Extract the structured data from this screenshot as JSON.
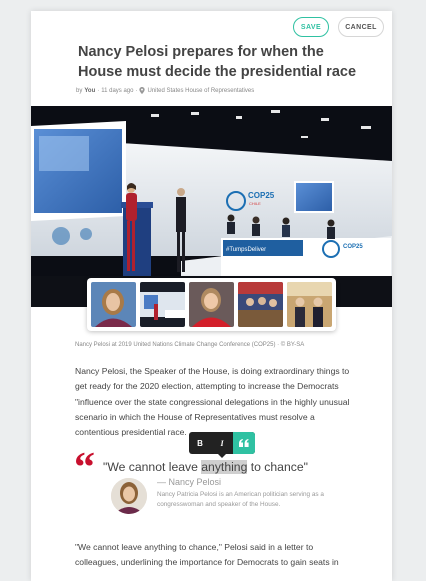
{
  "toolbar": {
    "save_label": "SAVE",
    "cancel_label": "CANCEL"
  },
  "article": {
    "title": "Nancy Pelosi prepares for when the House must decide the presidential race",
    "meta": {
      "by": "by",
      "author": "You",
      "time": "11 days ago",
      "location": "United States House of Representatives"
    },
    "caption": "Nancy Pelosi at 2019 United Nations Climate Change Conference (COP25) · © BY-SA",
    "paragraph1": "Nancy Pelosi, the Speaker of the House, is doing extraordinary things to get ready for the 2020 election, attempting to increase the Democrats \"influence over the state congressional delegations in the highly unusual scenario in which the House of Representatives must resolve a contentious presidential race.",
    "paragraph2": "\"We cannot leave anything to chance,\" Pelosi said in a letter to colleagues, underlining the importance for Democrats to gain seats in"
  },
  "hero": {
    "banner_text": "#TumpsDeliver",
    "logo_text": "COP25",
    "logo_sub": "CHILE"
  },
  "format_toolbar": {
    "bold": "B",
    "italic": "I",
    "quote_icon": "quote-icon"
  },
  "quote": {
    "before": "\"We cannot leave ",
    "highlight": "anything",
    "after": " to chance\"",
    "author": "—  Nancy Pelosi",
    "bio": "Nancy Patricia Pelosi is an American politician serving as a congresswoman and speaker of the House."
  },
  "colors": {
    "accent": "#2fc1a2",
    "quote_mark": "#c8102e"
  }
}
